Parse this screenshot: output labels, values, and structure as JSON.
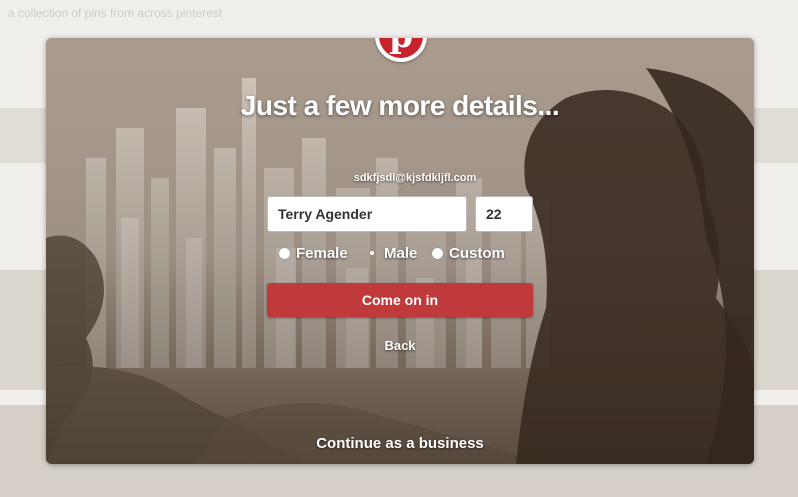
{
  "background_page": {
    "faint_header": "a collection of pins from across pinterest"
  },
  "modal": {
    "logo_letter": "p",
    "title": "Just a few more details...",
    "email": "sdkfjsdl@kjsfdkljfl.com",
    "name_value": "Terry Agender",
    "age_value": "22",
    "gender_options": [
      "Female",
      "Male",
      "Custom"
    ],
    "submit_label": "Come on in",
    "back_label": "Back",
    "business_label": "Continue as a business"
  },
  "colors": {
    "brand_red": "#c8232c",
    "button_red": "#c0393b"
  }
}
